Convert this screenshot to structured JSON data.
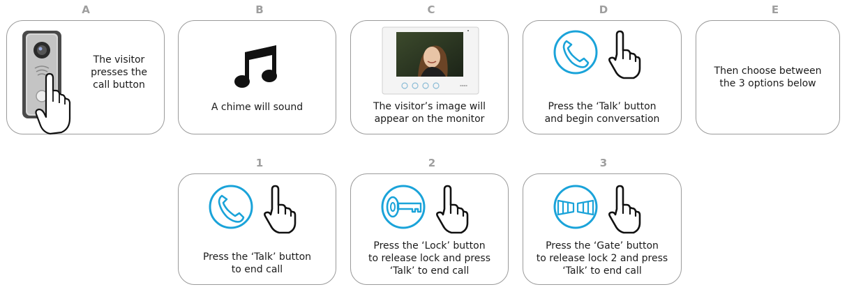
{
  "colors": {
    "accent": "#1aa3d9",
    "border": "#9a9a9a",
    "label": "#9e9e9e",
    "text": "#1a1a1a"
  },
  "steps": [
    {
      "label": "A",
      "caption": "The visitor\npresses the\ncall button",
      "icon": "door-station-icon"
    },
    {
      "label": "B",
      "caption": "A chime will sound",
      "icon": "music-note-icon"
    },
    {
      "label": "C",
      "caption": "The visitor’s image will\nappear on the monitor",
      "icon": "monitor-icon"
    },
    {
      "label": "D",
      "caption": "Press the ‘Talk’ button\nand begin conversation",
      "icon": "phone-icon"
    },
    {
      "label": "E",
      "caption": "Then choose between\nthe 3 options below",
      "icon": ""
    }
  ],
  "options": [
    {
      "label": "1",
      "caption": "Press the ‘Talk’ button\nto end call",
      "icon": "phone-icon"
    },
    {
      "label": "2",
      "caption": "Press the ‘Lock’ button\nto release lock and press\n‘Talk’ to end call",
      "icon": "key-icon"
    },
    {
      "label": "3",
      "caption": "Press the ‘Gate’ button\nto release lock 2 and press\n‘Talk’ to end call",
      "icon": "gate-icon"
    }
  ]
}
